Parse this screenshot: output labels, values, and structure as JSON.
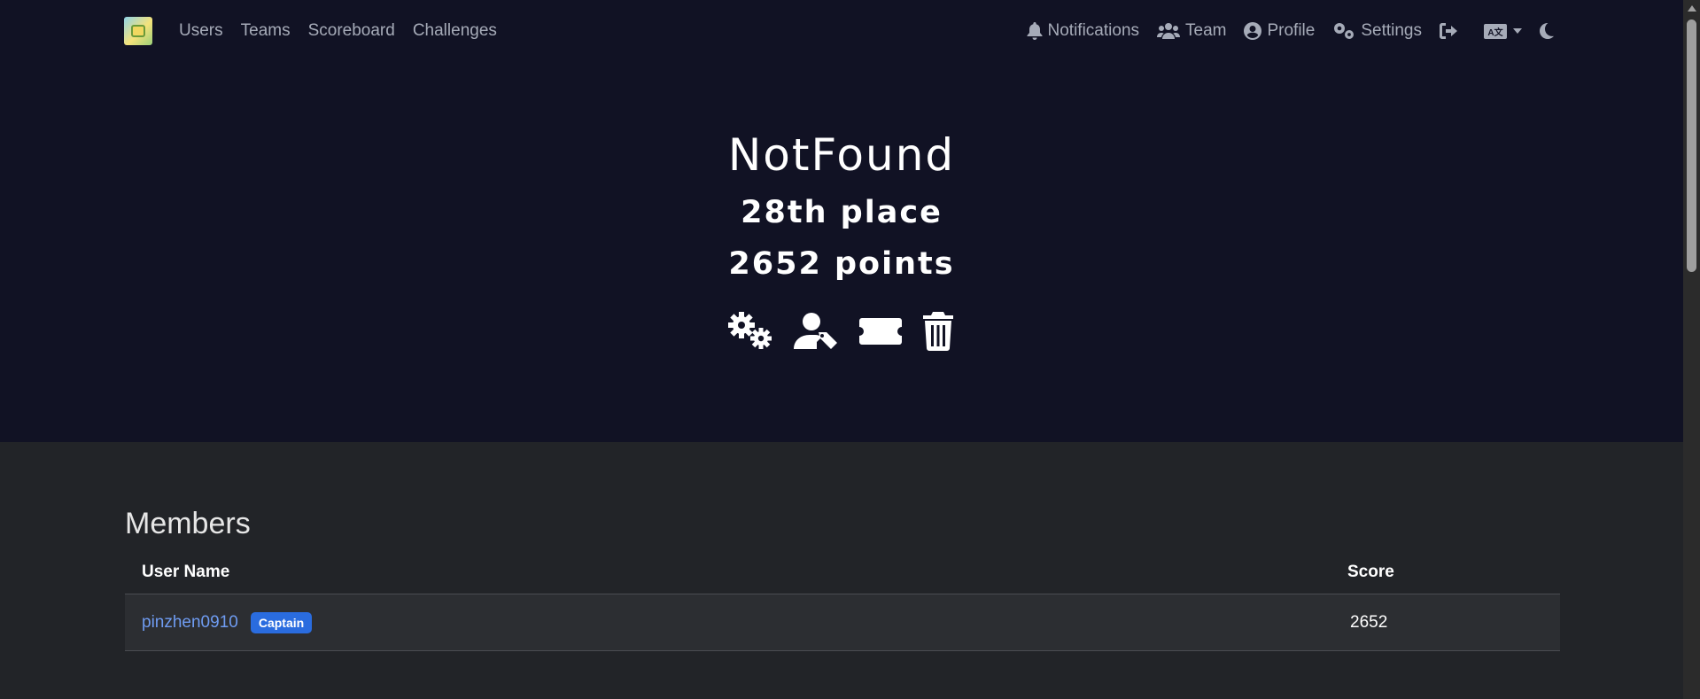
{
  "nav": {
    "left": [
      "Users",
      "Teams",
      "Scoreboard",
      "Challenges"
    ],
    "notifications": "Notifications",
    "team": "Team",
    "profile": "Profile",
    "settings": "Settings",
    "language_icon": "language-icon",
    "theme_icon": "moon-icon"
  },
  "team": {
    "name": "NotFound",
    "place": "28th place",
    "points": "2652 points"
  },
  "actions": [
    "settings-gears-icon",
    "user-tag-icon",
    "ticket-icon",
    "trash-icon"
  ],
  "members": {
    "title": "Members",
    "columns": {
      "name": "User Name",
      "score": "Score"
    },
    "rows": [
      {
        "name": "pinzhen0910",
        "badge": "Captain",
        "score": "2652"
      }
    ]
  },
  "colors": {
    "hero_bg": "#111224",
    "body_bg": "#222428",
    "link": "#6f9cf2",
    "badge": "#2a6cdf"
  }
}
